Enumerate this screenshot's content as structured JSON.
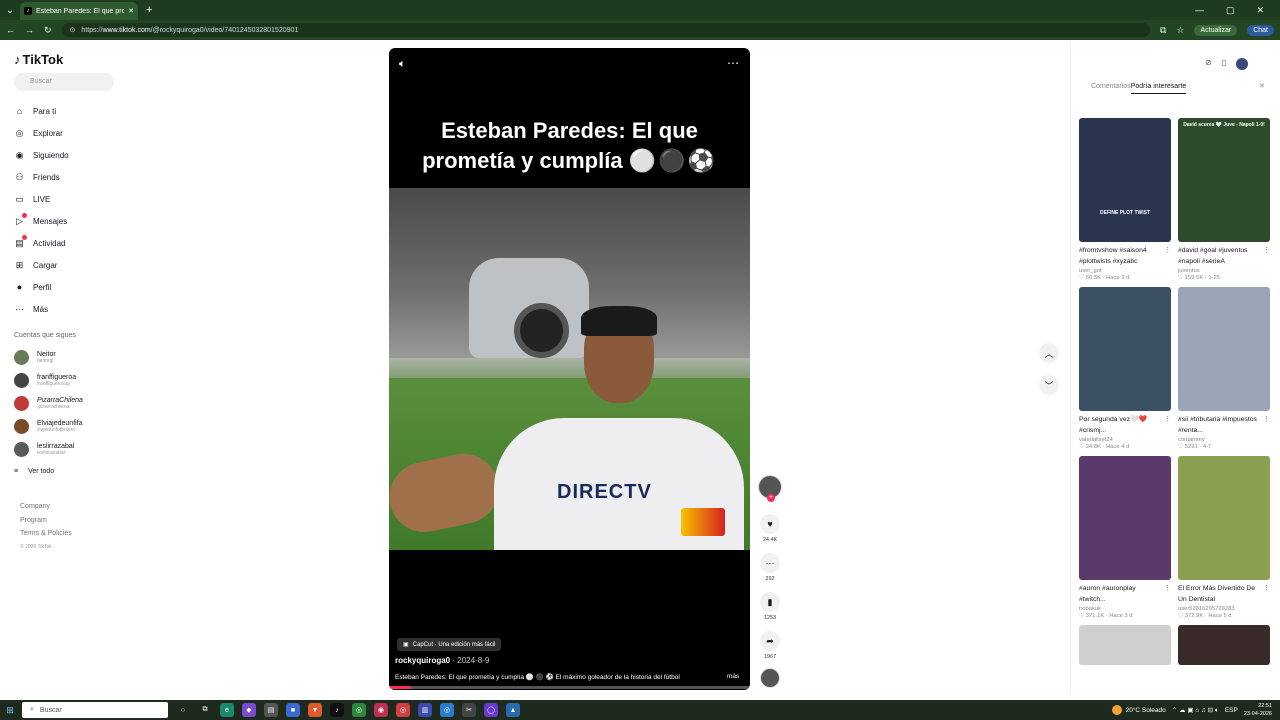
{
  "browser": {
    "tab_title": "Esteban Paredes: El que prometí",
    "url_prefix": "https://",
    "url_host": "www.tiktok.com",
    "url_path": "/@rockyquiroga0/video/7401245032801520901",
    "update_label": "Actualizar",
    "chat_label": "Chat"
  },
  "sidebar": {
    "logo": "TikTok",
    "search_placeholder": "Buscar",
    "nav": [
      {
        "label": "Para ti",
        "icon": "home-icon"
      },
      {
        "label": "Explorar",
        "icon": "compass-icon"
      },
      {
        "label": "Siguiendo",
        "icon": "following-icon"
      },
      {
        "label": "Friends",
        "icon": "friends-icon"
      },
      {
        "label": "LIVE",
        "icon": "live-icon"
      },
      {
        "label": "Mensajes",
        "icon": "messages-icon"
      },
      {
        "label": "Actividad",
        "icon": "activity-icon"
      },
      {
        "label": "Cargar",
        "icon": "upload-icon"
      },
      {
        "label": "Perfil",
        "icon": "profile-icon"
      },
      {
        "label": "Más",
        "icon": "more-icon"
      }
    ],
    "following_label": "Cuentas que sigues",
    "accounts": [
      {
        "name": "Neitor",
        "handle": "neitorgl"
      },
      {
        "name": "franffigueroa",
        "handle": "franffiguerosaji"
      },
      {
        "name": "PizarraChilena",
        "handle": ".pizarrachilena"
      },
      {
        "name": "Elviajedeunfifa",
        "handle": "viajedunfutbolero"
      },
      {
        "name": "leslirrazabal",
        "handle": "lesliirrazabar"
      }
    ],
    "see_all": "Ver todo",
    "footer": [
      "Company",
      "Program",
      "Terms & Policies"
    ],
    "copyright": "© 2026 TikTok"
  },
  "video": {
    "title_line1": "Esteban Paredes: El que",
    "title_line2": "prometía y cumplía",
    "title_emoji": "⚪⚫⚽",
    "jersey_text": "DIRECTV",
    "capcut_label": "CapCut · Una edición más fácil",
    "author": "rockyquiroga0",
    "date": " · 2024-8-9",
    "description": "Esteban Paredes: El que prometía y cumplía ⚪ ⚫ ⚽ El máximo goleador de la historia del fútbol",
    "more_label": "más",
    "progress": 0.06
  },
  "rail": {
    "likes": "24.4K",
    "comments": "292",
    "saves": "1253",
    "shares": "1967"
  },
  "right_panel": {
    "tab_comments": "Comentarios",
    "tab_interest": "Podría interesarte",
    "cards": [
      {
        "caption": "#fromtvshow #saison4 #plottwists #xyzabc",
        "user": "user_got",
        "stats": "♡ 60.5K · Hace 3 d",
        "overlay": "DEFINE PLOT TWIST",
        "bg": "#2a3550"
      },
      {
        "caption": "#david #goal #juventus #napoli #serieA",
        "user": "juventus",
        "stats": "♡ 159.5K · 1-25",
        "overlay": "David scores 🤍 Juve - Napoli 1-0!",
        "bg": "#2d4a2a"
      },
      {
        "caption": "Por segunda vez🤍❤️ #crismj...",
        "user": "valerialiset24",
        "stats": "♡ 24.8K · Hace 4 d",
        "overlay": "",
        "bg": "#3c5064"
      },
      {
        "caption": "#sii #tributaria #impuestos #renta...",
        "user": "contammy",
        "stats": "♡ 5291 · 4-7",
        "overlay": "",
        "bg": "#9aa5b8"
      },
      {
        "caption": "#auron #auronplay #twitch...",
        "user": "hobakuk",
        "stats": "♡ 371.1K · Hace 3 d",
        "overlay": "",
        "bg": "#5a3a6a"
      },
      {
        "caption": "El Error Más Divertido De Un Dentistal",
        "user": "user52816295729283",
        "stats": "♡ 372.9K · Hace 5 d",
        "overlay": "",
        "bg": "#8aa050"
      },
      {
        "caption": "",
        "user": "",
        "stats": "",
        "overlay": "",
        "bg": "#cfcfcf"
      },
      {
        "caption": "",
        "user": "",
        "stats": "",
        "overlay": "",
        "bg": "#3a2a2a"
      }
    ]
  },
  "taskbar": {
    "search_label": "Buscar",
    "weather": "20°C  Soleado",
    "language": "ESP",
    "time": "22:51",
    "date": "23-04-2026"
  }
}
